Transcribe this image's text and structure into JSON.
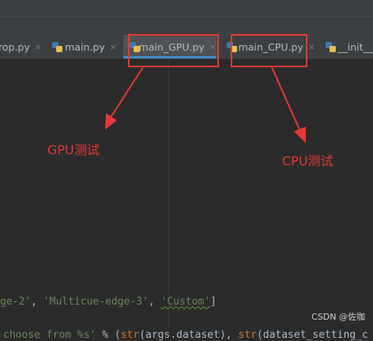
{
  "tabs": [
    {
      "label": "rop.py",
      "close": "×"
    },
    {
      "label": "main.py",
      "close": "×"
    },
    {
      "label": "main_GPU.py",
      "close": "×"
    },
    {
      "label": "main_CPU.py",
      "close": "×"
    },
    {
      "label": "__init__.",
      "close": ""
    }
  ],
  "code": {
    "line1": {
      "s1": "ge-2'",
      "p1": ", ",
      "s2": "'Multicue-edge-3'",
      "p2": ", ",
      "s3": "'Custom'",
      "p3": "]"
    },
    "line2": {
      "s1": "choose from %s'",
      "p1": " % (",
      "k1": "str",
      "p2": "(args.dataset), ",
      "k2": "str",
      "p3": "(dataset_setting_c"
    }
  },
  "annotations": {
    "gpu": "GPU测试",
    "cpu": "CPU测试"
  },
  "colors": {
    "annotation": "#e53935",
    "active_tab_underline": "#4a88c7"
  },
  "watermark": "CSDN @佐咖"
}
